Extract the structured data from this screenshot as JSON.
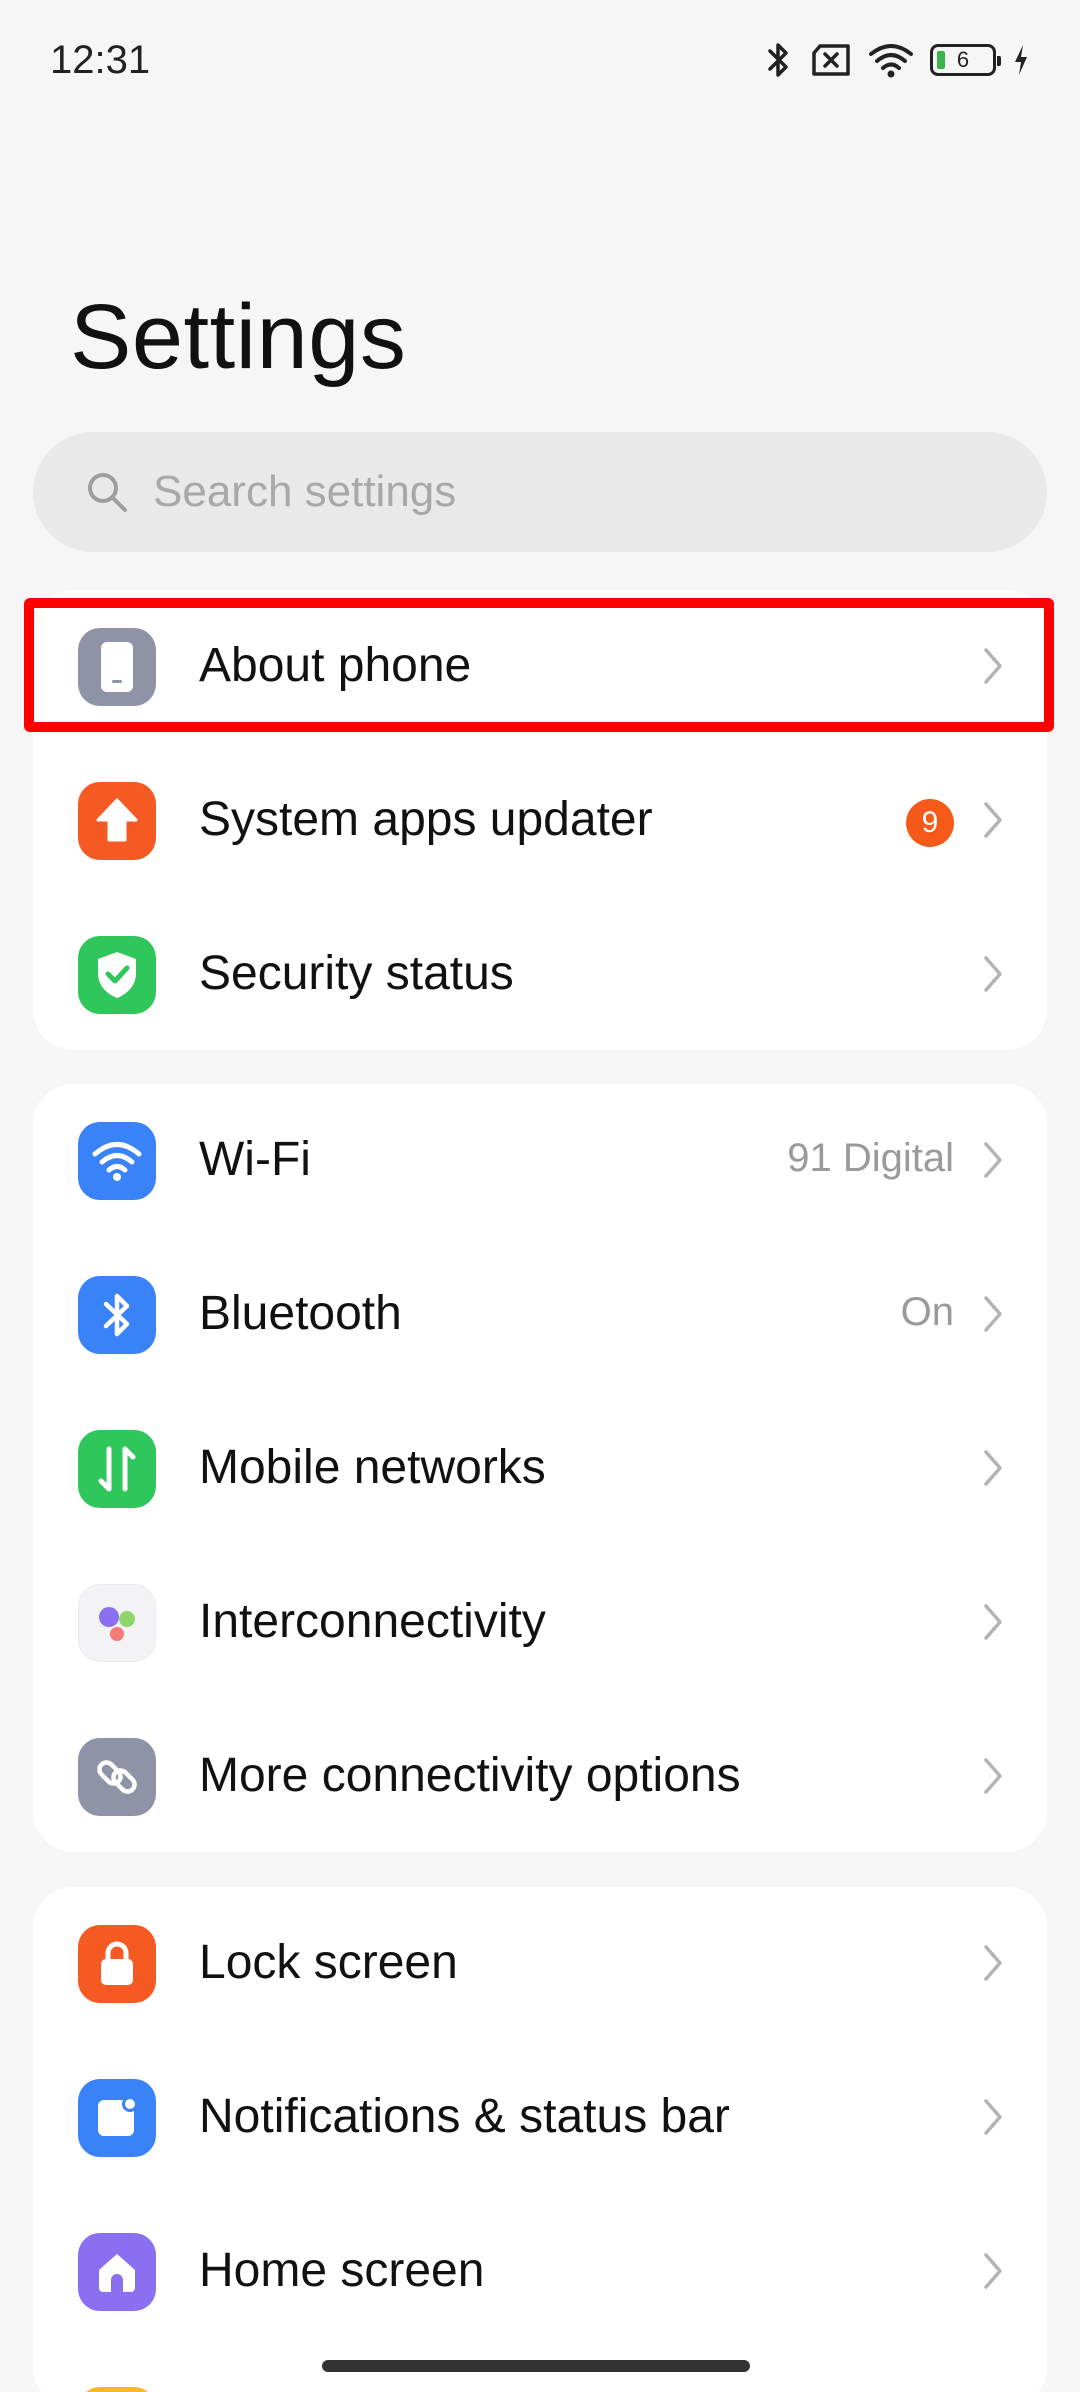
{
  "status_bar": {
    "time": "12:31",
    "battery_level": "6",
    "icons": [
      "bluetooth-icon",
      "no-sim-icon",
      "wifi-icon",
      "battery-icon",
      "charging-icon"
    ]
  },
  "page": {
    "title": "Settings"
  },
  "search": {
    "placeholder": "Search settings",
    "icon": "search-icon"
  },
  "groups": [
    {
      "items": [
        {
          "label": "About phone",
          "value": "",
          "icon": "phone-icon",
          "color": "#8e93a6"
        },
        {
          "label": "System apps updater",
          "badge": "9",
          "icon": "upload-arrow-icon",
          "color": "#f55a23"
        },
        {
          "label": "Security status",
          "value": "",
          "icon": "shield-check-icon",
          "color": "#2fc65b"
        }
      ]
    },
    {
      "items": [
        {
          "label": "Wi-Fi",
          "value": "91 Digital",
          "icon": "wifi-icon",
          "color": "#3a82f7"
        },
        {
          "label": "Bluetooth",
          "value": "On",
          "icon": "bluetooth-icon",
          "color": "#3a82f7"
        },
        {
          "label": "Mobile networks",
          "value": "",
          "icon": "mobile-data-icon",
          "color": "#2fc65b"
        },
        {
          "label": "Interconnectivity",
          "value": "",
          "icon": "interconnectivity-icon",
          "color": "#f3f3f5"
        },
        {
          "label": "More connectivity options",
          "value": "",
          "icon": "link-icon",
          "color": "#8e93a6"
        }
      ]
    },
    {
      "items": [
        {
          "label": "Lock screen",
          "value": "",
          "icon": "lock-icon",
          "color": "#f55a23"
        },
        {
          "label": "Notifications & status bar",
          "value": "",
          "icon": "notification-icon",
          "color": "#3a82f7"
        },
        {
          "label": "Home screen",
          "value": "",
          "icon": "home-icon",
          "color": "#8a70f0"
        }
      ]
    }
  ],
  "highlight": {
    "color": "#ff0000"
  }
}
